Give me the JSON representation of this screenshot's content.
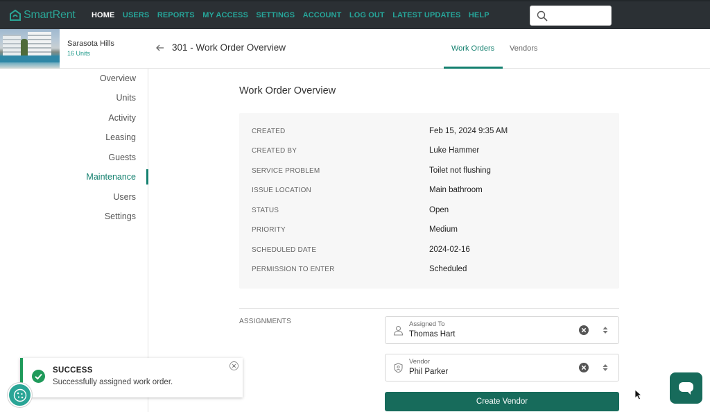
{
  "brand": {
    "name": "SmartRent",
    "accent": "#2aa596",
    "primary": "#176b5b"
  },
  "nav": {
    "items": [
      {
        "label": "HOME",
        "active": true
      },
      {
        "label": "USERS",
        "active": false
      },
      {
        "label": "REPORTS",
        "active": false
      },
      {
        "label": "MY ACCESS",
        "active": false
      },
      {
        "label": "SETTINGS",
        "active": false
      },
      {
        "label": "ACCOUNT",
        "active": false
      },
      {
        "label": "LOG OUT",
        "active": false
      },
      {
        "label": "LATEST UPDATES",
        "active": false
      },
      {
        "label": "HELP",
        "active": false
      }
    ],
    "search": {
      "value": "",
      "placeholder": "",
      "icon": "search-icon"
    }
  },
  "property": {
    "name": "Sarasota Hills",
    "units": "16 Units"
  },
  "sidebar": {
    "items": [
      {
        "label": "Overview",
        "active": false
      },
      {
        "label": "Units",
        "active": false
      },
      {
        "label": "Activity",
        "active": false
      },
      {
        "label": "Leasing",
        "active": false
      },
      {
        "label": "Guests",
        "active": false
      },
      {
        "label": "Maintenance",
        "active": true
      },
      {
        "label": "Users",
        "active": false
      },
      {
        "label": "Settings",
        "active": false
      }
    ]
  },
  "header": {
    "title": "301 - Work Order Overview",
    "tabs": [
      {
        "label": "Work Orders",
        "active": true
      },
      {
        "label": "Vendors",
        "active": false
      }
    ]
  },
  "overview": {
    "title": "Work Order Overview",
    "rows": [
      {
        "label": "CREATED",
        "value": "Feb 15, 2024 9:35 AM"
      },
      {
        "label": "CREATED BY",
        "value": "Luke Hammer"
      },
      {
        "label": "SERVICE PROBLEM",
        "value": "Toilet not flushing"
      },
      {
        "label": "ISSUE LOCATION",
        "value": "Main bathroom"
      },
      {
        "label": "STATUS",
        "value": "Open"
      },
      {
        "label": "PRIORITY",
        "value": "Medium"
      },
      {
        "label": "SCHEDULED DATE",
        "value": "2024-02-16"
      },
      {
        "label": "PERMISSION TO ENTER",
        "value": "Scheduled"
      }
    ]
  },
  "assignments": {
    "label": "ASSIGNMENTS",
    "assigned_to": {
      "label": "Assigned To",
      "value": "Thomas Hart"
    },
    "vendor": {
      "label": "Vendor",
      "value": "Phil Parker"
    },
    "create_vendor_label": "Create Vendor"
  },
  "toast": {
    "title": "SUCCESS",
    "message": "Successfully assigned work order.",
    "color": "#1f9a5a"
  }
}
